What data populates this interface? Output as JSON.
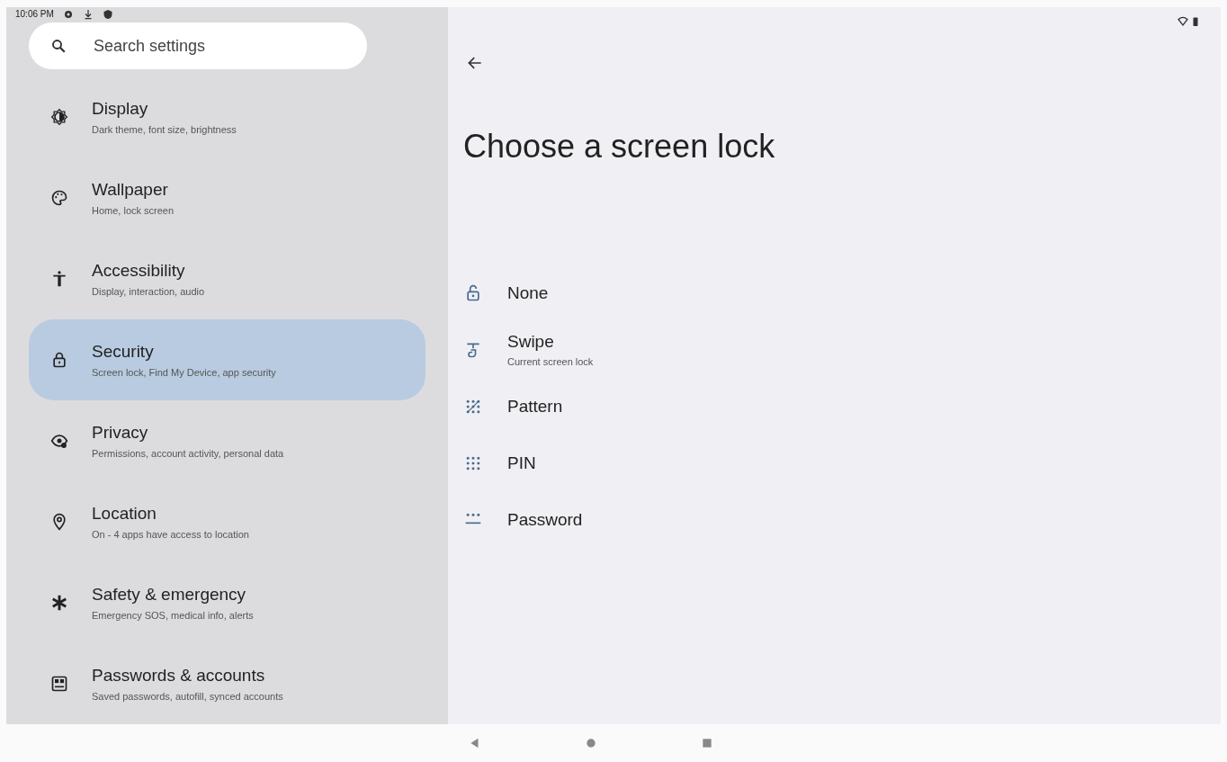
{
  "status_bar": {
    "time": "10:06 PM"
  },
  "search": {
    "placeholder": "Search settings"
  },
  "sidebar": {
    "items": [
      {
        "title": "Display",
        "subtitle": "Dark theme, font size, brightness",
        "selected": false
      },
      {
        "title": "Wallpaper",
        "subtitle": "Home, lock screen",
        "selected": false
      },
      {
        "title": "Accessibility",
        "subtitle": "Display, interaction, audio",
        "selected": false
      },
      {
        "title": "Security",
        "subtitle": "Screen lock, Find My Device, app security",
        "selected": true
      },
      {
        "title": "Privacy",
        "subtitle": "Permissions, account activity, personal data",
        "selected": false
      },
      {
        "title": "Location",
        "subtitle": "On - 4 apps have access to location",
        "selected": false
      },
      {
        "title": "Safety & emergency",
        "subtitle": "Emergency SOS, medical info, alerts",
        "selected": false
      },
      {
        "title": "Passwords & accounts",
        "subtitle": "Saved passwords, autofill, synced accounts",
        "selected": false
      }
    ]
  },
  "page": {
    "title": "Choose a screen lock",
    "options": [
      {
        "label": "None"
      },
      {
        "label": "Swipe",
        "subtitle": "Current screen lock"
      },
      {
        "label": "Pattern"
      },
      {
        "label": "PIN"
      },
      {
        "label": "Password"
      }
    ]
  }
}
